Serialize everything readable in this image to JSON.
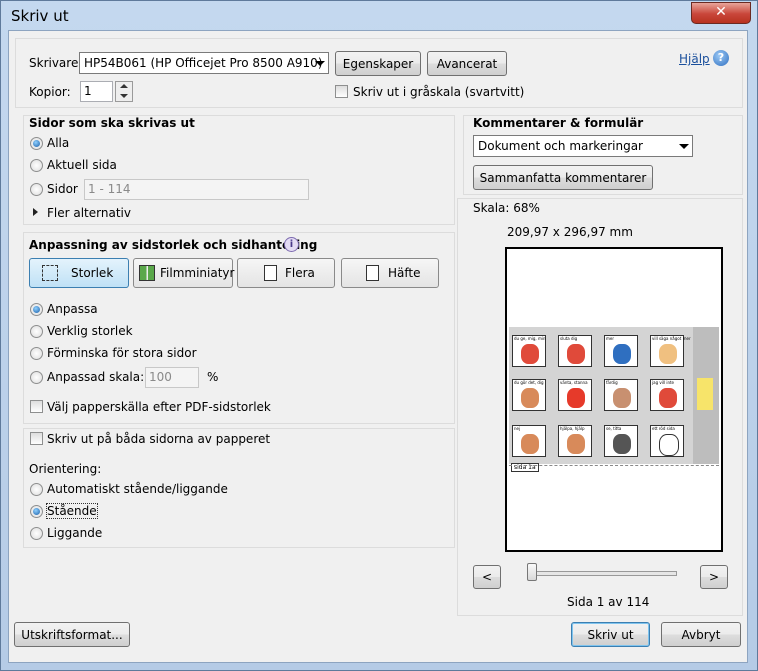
{
  "window": {
    "title": "Skriv ut",
    "close_glyph": "✕"
  },
  "top": {
    "printer_label": "Skrivare:",
    "printer_value": "HP54B061 (HP Officejet Pro 8500 A910)",
    "properties_button": "Egenskaper",
    "advanced_button": "Avancerat",
    "help_link": "Hjälp",
    "copies_label": "Kopior:",
    "copies_value": "1",
    "grayscale_label": "Skriv ut i gråskala (svartvitt)"
  },
  "pages": {
    "heading": "Sidor som ska skrivas ut",
    "all": "Alla",
    "current": "Aktuell sida",
    "pages": "Sidor",
    "range_placeholder": "1 - 114",
    "more": "Fler alternativ"
  },
  "sizing": {
    "heading": "Anpassning av sidstorlek och sidhantering",
    "tabs": [
      "Storlek",
      "Filmminiatyr",
      "Flera",
      "Häfte"
    ],
    "fit": "Anpassa",
    "actual": "Verklig storlek",
    "shrink": "Förminska för stora sidor",
    "custom": "Anpassad skala:",
    "custom_value": "100",
    "percent": "%",
    "paper_source": "Välj papperskälla efter PDF-sidstorlek"
  },
  "duplex": {
    "label": "Skriv ut på båda sidorna av papperet"
  },
  "orientation": {
    "heading": "Orientering:",
    "auto": "Automatiskt stående/liggande",
    "portrait": "Stående",
    "landscape": "Liggande"
  },
  "comments": {
    "heading": "Kommentarer & formulär",
    "value": "Dokument och markeringar",
    "summarize_button": "Sammanfatta kommentarer"
  },
  "preview": {
    "scale": "Skala:  68%",
    "dimensions": "209,97 x 296,97 mm",
    "page_status": "Sida 1 av 114",
    "prev": "<",
    "next": ">",
    "page_tag": "sida 1a",
    "tile_captions": [
      "du ge, mig, min",
      "sluta dig",
      "mer",
      "vill säga något mer",
      "du gör det, dig",
      "vänta, stanna",
      "färdig",
      "jag vill inte",
      "nej",
      "hjälpa, hjälp",
      "se, titta",
      "ett röd sida"
    ]
  },
  "bottom": {
    "page_setup": "Utskriftsformat...",
    "print": "Skriv ut",
    "cancel": "Avbryt"
  },
  "colors": {
    "frame": "#c4d8ef",
    "close": "#c9463a",
    "accent": "#3c7fb1"
  }
}
